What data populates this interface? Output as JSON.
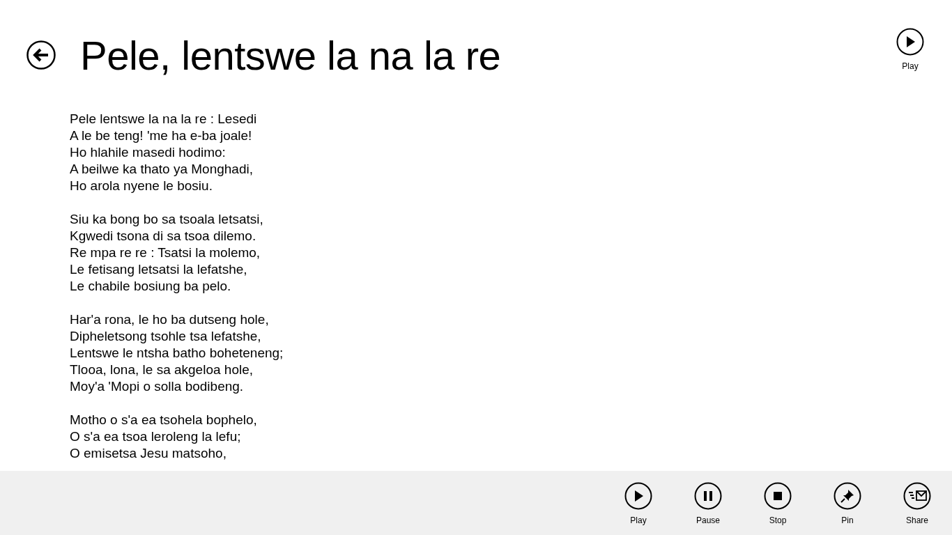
{
  "header": {
    "title": "Pele, lentswe la na la re",
    "play_button": {
      "label": "Play",
      "kind": "play"
    }
  },
  "lyrics": [
    [
      "Pele lentswe la na la re : Lesedi",
      "A le be teng! 'me ha e-ba joale!",
      "Ho hlahile masedi hodimo:",
      "A beilwe ka thato ya Monghadi,",
      "Ho arola nyene le bosiu."
    ],
    [
      "Siu ka bong bo sa tsoala letsatsi,",
      "Kgwedi tsona di sa tsoa dilemo.",
      "Re mpa re re : Tsatsi la molemo,",
      "Le fetisang letsatsi la lefatshe,",
      "Le chabile bosiung ba pelo."
    ],
    [
      "Har'a rona, le ho ba dutseng hole,",
      "Dipheletsong tsohle tsa lefatshe,",
      "Lentswe le ntsha batho boheteneng;",
      "Tlooa, lona, le sa akgeloa hole,",
      "Moy'a 'Mopi o solla bodibeng."
    ],
    [
      "Motho o s'a ea tsohela bophelo,",
      "O s'a ea tsoa leroleng la lefu;",
      "O emisetsa Jesu matsoho,"
    ]
  ],
  "app_bar": [
    {
      "label": "Play",
      "kind": "play"
    },
    {
      "label": "Pause",
      "kind": "pause"
    },
    {
      "label": "Stop",
      "kind": "stop"
    },
    {
      "label": "Pin",
      "kind": "pin"
    },
    {
      "label": "Share",
      "kind": "share"
    }
  ]
}
